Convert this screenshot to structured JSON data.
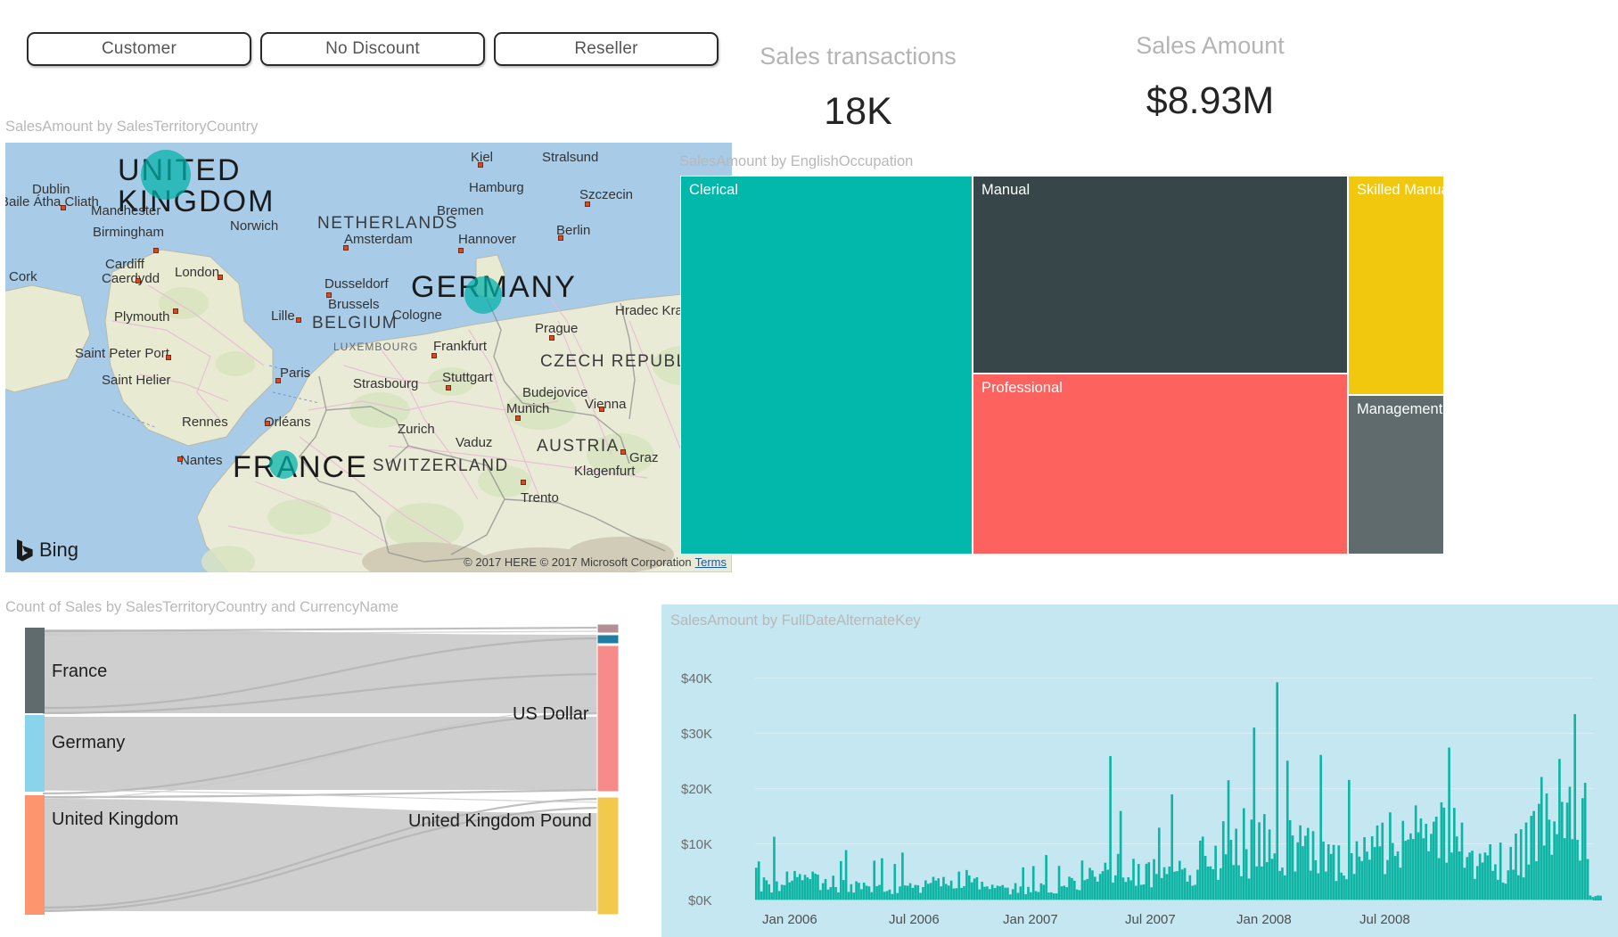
{
  "slicers": [
    {
      "label": "Customer",
      "name": "slicer-customer"
    },
    {
      "label": "No Discount",
      "name": "slicer-no-discount"
    },
    {
      "label": "Reseller",
      "name": "slicer-reseller"
    }
  ],
  "kpis": [
    {
      "title": "Sales transactions",
      "value": "18K"
    },
    {
      "title": "Sales Amount",
      "value": "$8.93M"
    }
  ],
  "map": {
    "title": "SalesAmount by SalesTerritoryCountry",
    "provider": "Bing",
    "attribution": "© 2017 HERE © 2017 Microsoft Corporation",
    "terms": "Terms",
    "bubble_color": "#00b2a9",
    "countries_big": [
      {
        "line1": "UNITED",
        "line2": "KINGDOM"
      },
      {
        "line1": "GERMANY"
      },
      {
        "line1": "FRANCE"
      }
    ],
    "countries_mid": [
      "NETHERLANDS",
      "BELGIUM",
      "LUXEMBOURG",
      "CZECH REPUBLIC",
      "AUSTRIA",
      "SWITZERLAND"
    ],
    "cities": [
      "Dublin",
      "Baile Átha Cliath",
      "Cork",
      "Manchester",
      "Birmingham",
      "Cardiff",
      "Caerdydd",
      "London",
      "Norwich",
      "Plymouth",
      "Saint Peter Port",
      "Saint Helier",
      "Rennes",
      "Nantes",
      "Orléans",
      "Paris",
      "Lille",
      "Brussels",
      "Amsterdam",
      "Bremen",
      "Hamburg",
      "Kiel",
      "Stralsund",
      "Szczecin",
      "Berlin",
      "Hannover",
      "Dusseldorf",
      "Cologne",
      "Frankfurt",
      "Prague",
      "Hradec Kral",
      "Strasbourg",
      "Stuttgart",
      "Zurich",
      "Vaduz",
      "Munich",
      "Budejovice",
      "Vienna",
      "Klagenfurt",
      "Trento",
      "Graz"
    ]
  },
  "treemap": {
    "title": "SalesAmount by EnglishOccupation",
    "chart_data": {
      "type": "treemap",
      "title": "SalesAmount by EnglishOccupation",
      "categories": [
        "Clerical",
        "Manual",
        "Professional",
        "Skilled Manual",
        "Management"
      ],
      "values": [
        2.52,
        2.35,
        2.06,
        1.32,
        0.68
      ],
      "colors": [
        "#01b8aa",
        "#374649",
        "#fd625e",
        "#f2c80f",
        "#5f6b6d"
      ]
    }
  },
  "sankey": {
    "title": "Count of Sales by SalesTerritoryCountry and CurrencyName",
    "chart_data": {
      "type": "sankey",
      "title": "Count of Sales by SalesTerritoryCountry and CurrencyName",
      "sources": [
        {
          "label": "France",
          "color": "#5f6b6d",
          "value": 34
        },
        {
          "label": "Germany",
          "color": "#8ad4eb",
          "value": 30
        },
        {
          "label": "United Kingdom",
          "color": "#fd966f",
          "value": 36
        }
      ],
      "targets": [
        {
          "label": "",
          "color": "#b49096",
          "value": 1
        },
        {
          "label": "",
          "color": "#1f7da3",
          "value": 1.5
        },
        {
          "label": "US Dollar",
          "color": "#f78b8a",
          "value": 62
        },
        {
          "label": "United Kingdom Pound",
          "color": "#f2c94c",
          "value": 35
        }
      ]
    }
  },
  "barchart": {
    "title": "SalesAmount by FullDateAlternateKey",
    "chart_data": {
      "type": "bar",
      "title": "SalesAmount by FullDateAlternateKey",
      "xlabel": "",
      "ylabel": "",
      "ylim": [
        0,
        44000
      ],
      "ytick_labels": [
        "$0K",
        "$10K",
        "$20K",
        "$30K",
        "$40K"
      ],
      "ytick_values": [
        0,
        10000,
        20000,
        30000,
        40000
      ],
      "xtick_labels": [
        "Jan 2006",
        "Jul 2006",
        "Jan 2007",
        "Jul 2007",
        "Jan 2008",
        "Jul 2008"
      ],
      "series_color": "#0fb5a4",
      "background": "#c4e7f2",
      "grid": true,
      "note": "Daily SalesAmount, ~Jul 2005 through Jul 2008; dense spiky bars trending upward"
    }
  }
}
